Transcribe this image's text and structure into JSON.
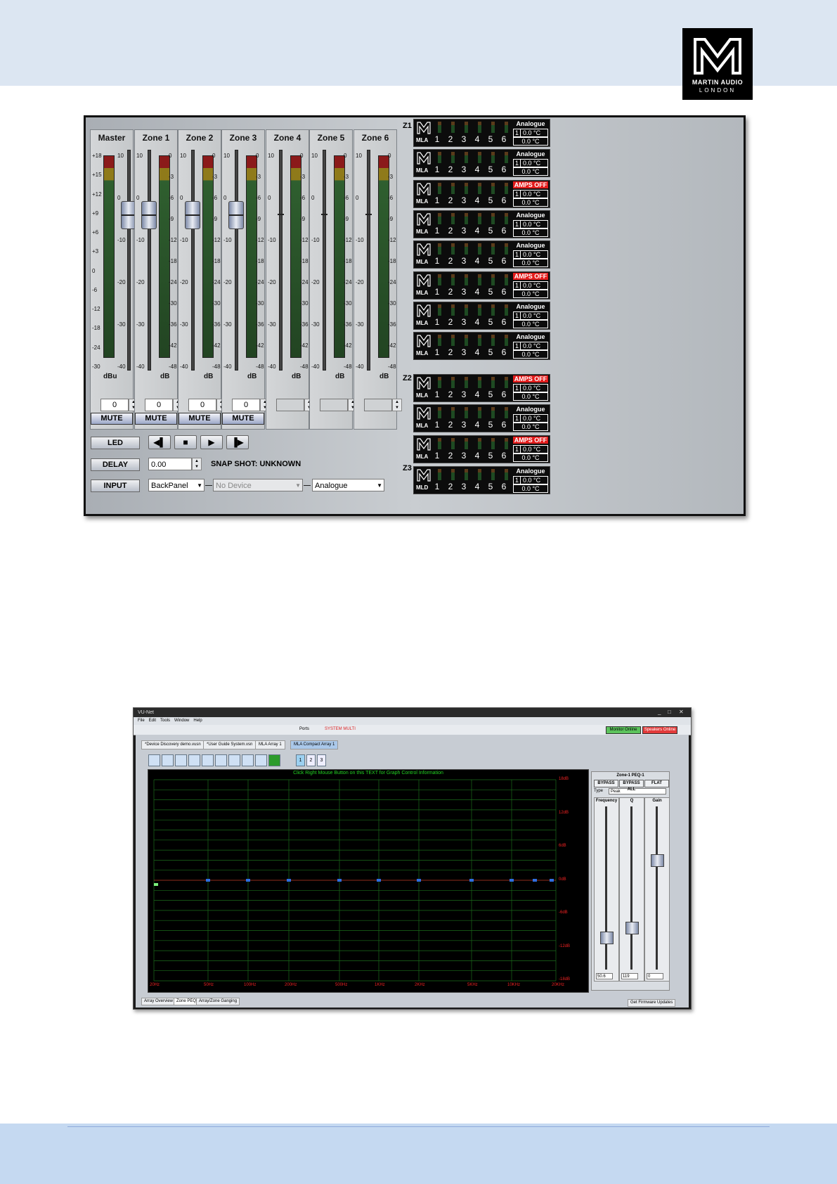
{
  "logo": {
    "line1": "MARTIN AUDIO",
    "line2": "LONDON"
  },
  "mixer": {
    "strips": [
      {
        "title": "Master",
        "unit": "dBu",
        "spin": "0",
        "mute": "MUTE"
      },
      {
        "title": "Zone 1",
        "unit": "dB",
        "spin": "0",
        "mute": "MUTE"
      },
      {
        "title": "Zone 2",
        "unit": "dB",
        "spin": "0",
        "mute": "MUTE"
      },
      {
        "title": "Zone 3",
        "unit": "dB",
        "spin": "0",
        "mute": "MUTE"
      },
      {
        "title": "Zone 4",
        "unit": "dB",
        "spin": "",
        "mute": ""
      },
      {
        "title": "Zone 5",
        "unit": "dB",
        "spin": "",
        "mute": ""
      },
      {
        "title": "Zone 6",
        "unit": "dB",
        "spin": "",
        "mute": ""
      }
    ],
    "master_scale_left": [
      "+18",
      "+15",
      "+12",
      "+9",
      "+6",
      "+3",
      "0",
      "-6",
      "-12",
      "-18",
      "-24",
      "-30"
    ],
    "master_scale_right": [
      "10",
      "0",
      "-10",
      "-20",
      "-30",
      "-40"
    ],
    "zone_scale_left": [
      "10",
      "0",
      "-10",
      "-20",
      "-30",
      "-40"
    ],
    "zone_scale_right": [
      "0",
      "-3",
      "-6",
      "-9",
      "-12",
      "-18",
      "-24",
      "-30",
      "-36",
      "-42",
      "-48"
    ],
    "led_label": "LED",
    "delay_label": "DELAY",
    "delay_value": "0.00",
    "snapshot": "SNAP SHOT: UNKNOWN",
    "input_label": "INPUT",
    "input_source": "BackPanel",
    "input_device": "No Device",
    "input_type": "Analogue"
  },
  "amps": {
    "zone_labels": [
      "Z1",
      "Z2",
      "Z3"
    ],
    "channels": [
      "1",
      "2",
      "3",
      "4",
      "5",
      "6"
    ],
    "units": [
      {
        "model": "MLA",
        "source": "Analogue",
        "status_off": false,
        "ch": "1",
        "temp1": "0.0 °C",
        "temp2": "0.0 °C"
      },
      {
        "model": "MLA",
        "source": "Analogue",
        "status_off": false,
        "ch": "1",
        "temp1": "0.0 °C",
        "temp2": "0.0 °C"
      },
      {
        "model": "MLA",
        "source": "AMPS OFF",
        "status_off": true,
        "ch": "1",
        "temp1": "0.0 °C",
        "temp2": "0.0 °C"
      },
      {
        "model": "MLA",
        "source": "Analogue",
        "status_off": false,
        "ch": "1",
        "temp1": "0.0 °C",
        "temp2": "0.0 °C"
      },
      {
        "model": "MLA",
        "source": "Analogue",
        "status_off": false,
        "ch": "1",
        "temp1": "0.0 °C",
        "temp2": "0.0 °C"
      },
      {
        "model": "MLA",
        "source": "AMPS OFF",
        "status_off": true,
        "ch": "1",
        "temp1": "0.0 °C",
        "temp2": "0.0 °C"
      },
      {
        "model": "MLA",
        "source": "Analogue",
        "status_off": false,
        "ch": "1",
        "temp1": "0.0 °C",
        "temp2": "0.0 °C"
      },
      {
        "model": "MLA",
        "source": "Analogue",
        "status_off": false,
        "ch": "1",
        "temp1": "0.0 °C",
        "temp2": "0.0 °C"
      },
      {
        "model": "MLA",
        "source": "AMPS OFF",
        "status_off": true,
        "ch": "1",
        "temp1": "0.0 °C",
        "temp2": "0.0 °C"
      },
      {
        "model": "MLA",
        "source": "Analogue",
        "status_off": false,
        "ch": "1",
        "temp1": "0.0 °C",
        "temp2": "0.0 °C"
      },
      {
        "model": "MLA",
        "source": "AMPS OFF",
        "status_off": true,
        "ch": "1",
        "temp1": "0.0 °C",
        "temp2": "0.0 °C"
      },
      {
        "model": "MLD",
        "source": "Analogue",
        "status_off": false,
        "ch": "1",
        "temp1": "0.0 °C",
        "temp2": "0.0 °C"
      }
    ]
  },
  "vunet": {
    "title": "VU-Net",
    "menu": [
      "File",
      "Edit",
      "Tools",
      "Window",
      "Help"
    ],
    "toolbar_text": "Ports",
    "status_text": "SYSTEM MULTI",
    "status_online": "Monitor Online",
    "status_speakers": "Speakers Online",
    "tabs": [
      "*Device Discovery demo.vusn",
      "*User Guide System.vsn",
      "MLA Array 1",
      "MLA Compact Array 1"
    ],
    "pages": [
      "1",
      "2",
      "3"
    ],
    "graph_hint": "Click Right Mouse Button on this TEXT for Graph Control Information",
    "graph_x_labels": [
      "20Hz",
      "50Hz",
      "100Hz",
      "200Hz",
      "500Hz",
      "1KHz",
      "2KHz",
      "5KHz",
      "10KHz",
      "20KHz"
    ],
    "graph_y_labels": [
      "18dB",
      "12dB",
      "6dB",
      "0dB",
      "-6dB",
      "-12dB",
      "-18dB"
    ],
    "peq_title": "Zone-1 PEQ-1",
    "peq_buttons": [
      "BYPASS",
      "BYPASS ALL",
      "FLAT"
    ],
    "peq_type_label": "Type",
    "peq_type": "Peak",
    "peq_cols": [
      {
        "name": "Frequency",
        "value": "50.6"
      },
      {
        "name": "Q",
        "value": "119"
      },
      {
        "name": "Gain",
        "value": "0"
      }
    ],
    "bottom_tabs": [
      "Array Overview",
      "Zone PEQ",
      "Array/Zone Ganging"
    ],
    "firmware_button": "Get Firmware Updates"
  }
}
